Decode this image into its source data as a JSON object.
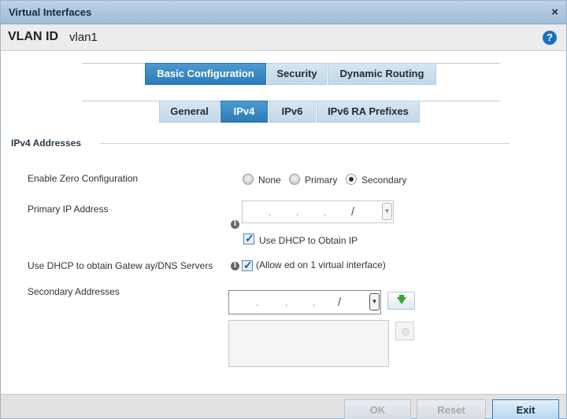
{
  "window": {
    "title": "Virtual Interfaces",
    "close_glyph": "×"
  },
  "header": {
    "vlan_label": "VLAN ID",
    "vlan_value": "vlan1",
    "help_glyph": "?"
  },
  "tabs_main": [
    {
      "label": "Basic Configuration",
      "active": true
    },
    {
      "label": "Security",
      "active": false
    },
    {
      "label": "Dynamic Routing",
      "active": false
    }
  ],
  "tabs_sub": [
    {
      "label": "General",
      "active": false
    },
    {
      "label": "IPv4",
      "active": true
    },
    {
      "label": "IPv6",
      "active": false
    },
    {
      "label": "IPv6 RA Prefixes",
      "active": false
    }
  ],
  "section": {
    "title": "IPv4 Addresses"
  },
  "zero_config": {
    "label": "Enable Zero Configuration",
    "options": [
      "None",
      "Primary",
      "Secondary"
    ],
    "selected": "Secondary"
  },
  "primary_ip": {
    "label": "Primary IP Address",
    "value": " .  .  . /"
  },
  "dhcp_obtain": {
    "label": "Use DHCP to Obtain IP",
    "checked": true
  },
  "dhcp_gateway": {
    "label": "Use DHCP to obtain Gatew ay/DNS Servers",
    "note": "(Allow ed on 1 virtual interface)",
    "checked": true
  },
  "secondary": {
    "label": "Secondary Addresses",
    "value": " .  .  . /"
  },
  "footer": {
    "ok": "OK",
    "reset": "Reset",
    "exit": "Exit"
  },
  "icons": {
    "info": "info-icon",
    "add": "add-arrow-icon",
    "remove": "remove-icon",
    "dropdown": "chevron-down-icon"
  },
  "colors": {
    "accent": "#2c7bb8",
    "titlebar": "#a9c6e0",
    "help": "#1c6fc2",
    "add_arrow": "#32a832"
  }
}
